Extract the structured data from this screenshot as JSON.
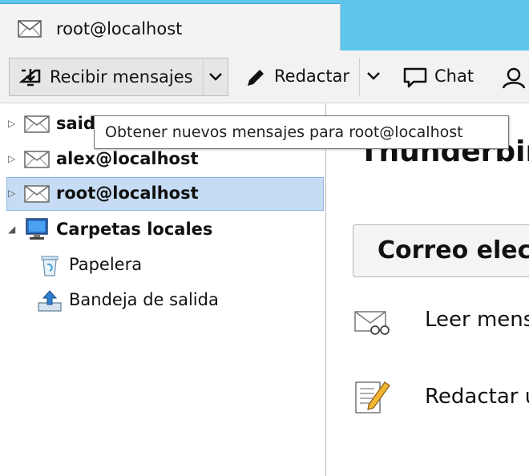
{
  "tab": {
    "label": "root@localhost",
    "icon": "envelope-icon"
  },
  "toolbar": {
    "get_messages_label": "Recibir mensajes",
    "write_label": "Redactar",
    "chat_label": "Chat"
  },
  "folders": [
    {
      "label": "said",
      "icon": "envelope-icon",
      "bold": true,
      "expanded": false
    },
    {
      "label": "alex@localhost",
      "icon": "envelope-icon",
      "bold": true,
      "expanded": false
    },
    {
      "label": "root@localhost",
      "icon": "envelope-icon",
      "bold": true,
      "expanded": false,
      "selected": true
    },
    {
      "label": "Carpetas locales",
      "icon": "computer-icon",
      "bold": true,
      "expanded": true
    },
    {
      "label": "Papelera",
      "icon": "trash-icon",
      "bold": false
    },
    {
      "label": "Bandeja de salida",
      "icon": "outbox-icon",
      "bold": false
    }
  ],
  "content": {
    "title": "Thunderbir",
    "section_label": "Correo elec",
    "actions": [
      {
        "label": "Leer mens",
        "icon": "read-messages-icon"
      },
      {
        "label": "Redactar u",
        "icon": "compose-icon"
      }
    ]
  },
  "tooltip": "Obtener nuevos mensajes para root@localhost",
  "colors": {
    "tabbar": "#5ec6ea",
    "selection": "#c6dcf4"
  }
}
